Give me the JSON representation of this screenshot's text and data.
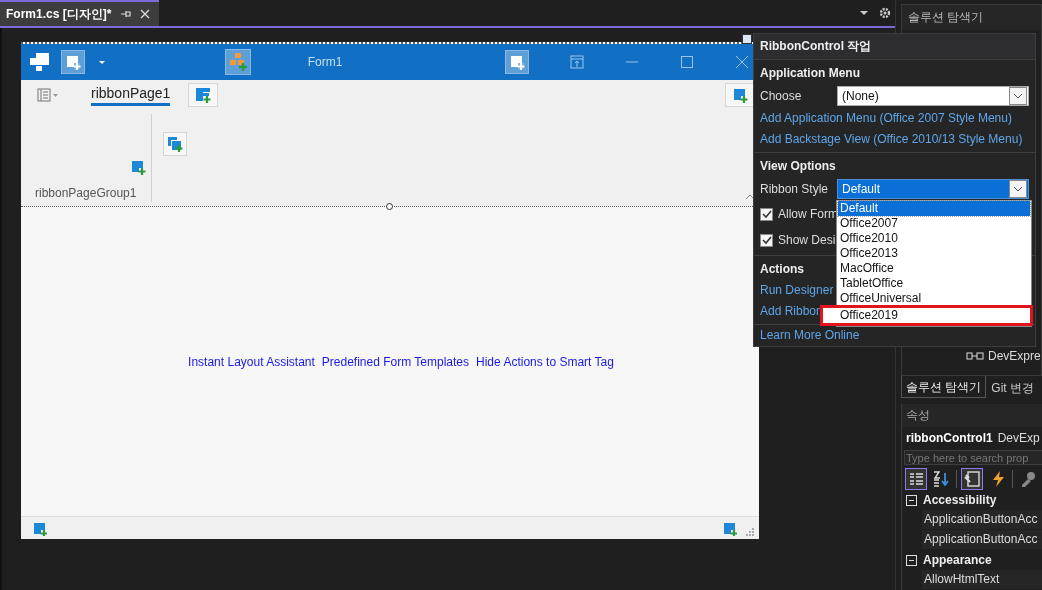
{
  "document_tab": {
    "title": "Form1.cs [디자인]*",
    "selected": true
  },
  "form": {
    "title": "Form1",
    "ribbon": {
      "page_tabs": [
        {
          "label": "ribbonPage1",
          "selected": true
        }
      ],
      "group": "ribbonPageGroup1"
    },
    "links": [
      "Instant Layout Assistant",
      "Predefined Form Templates",
      "Hide Actions to Smart Tag"
    ]
  },
  "smart_tag": {
    "title": "RibbonControl 작업",
    "sections": [
      {
        "heading": "Application Menu",
        "items": [
          {
            "kind": "combo",
            "label": "Choose",
            "value": "(None)",
            "open": false
          },
          {
            "kind": "link",
            "text": "Add Application Menu (Office 2007 Style Menu)"
          },
          {
            "kind": "link",
            "text": "Add Backstage View (Office 2010/13 Style Menu)"
          }
        ]
      },
      {
        "heading": "View Options",
        "items": [
          {
            "kind": "combo",
            "label": "Ribbon Style",
            "value": "Default",
            "open": true
          },
          {
            "kind": "check",
            "label": "Allow Form",
            "checked": true
          },
          {
            "kind": "check",
            "label": "Show Desi",
            "checked": true
          }
        ]
      },
      {
        "heading": "Actions",
        "items": [
          {
            "kind": "link",
            "text": "Run Designer"
          },
          {
            "kind": "link",
            "text": "Add Ribbon"
          }
        ]
      },
      {
        "items": [
          {
            "kind": "link",
            "text": "Learn More Online"
          }
        ]
      }
    ],
    "dropdown": {
      "options": [
        {
          "label": "Default",
          "selected": true,
          "outlined": false
        },
        {
          "label": "Office2007",
          "selected": false,
          "outlined": false
        },
        {
          "label": "Office2010",
          "selected": false,
          "outlined": false
        },
        {
          "label": "Office2013",
          "selected": false,
          "outlined": false
        },
        {
          "label": "MacOffice",
          "selected": false,
          "outlined": false
        },
        {
          "label": "TabletOffice",
          "selected": false,
          "outlined": false
        },
        {
          "label": "OfficeUniversal",
          "selected": false,
          "outlined": false
        },
        {
          "label": "Office2019",
          "selected": false,
          "outlined": true
        }
      ]
    }
  },
  "solution_explorer": {
    "title": "솔루션 탐색기",
    "tree": [
      {
        "text": "DevExpre"
      }
    ],
    "tabs": [
      {
        "label": "솔루션 탐색기",
        "selected": true
      },
      {
        "label": "Git 변경",
        "selected": false
      }
    ]
  },
  "properties": {
    "title": "속성",
    "object": "ribbonControl1",
    "type": "DevExp",
    "search_placeholder": "Type here to search prop",
    "toolbar": [
      {
        "kind": "categorized",
        "selected": true
      },
      {
        "kind": "alphabetical",
        "selected": false
      },
      {
        "kind": "properties",
        "selected": true
      },
      {
        "kind": "events",
        "selected": false
      },
      {
        "kind": "pages",
        "selected": false
      }
    ],
    "categories": [
      {
        "name": "Accessibility",
        "expanded": true,
        "properties": [
          "ApplicationButtonAcc",
          "ApplicationButtonAcc"
        ]
      },
      {
        "name": "Appearance",
        "expanded": true,
        "properties": [
          "AllowHtmlText"
        ]
      }
    ]
  }
}
